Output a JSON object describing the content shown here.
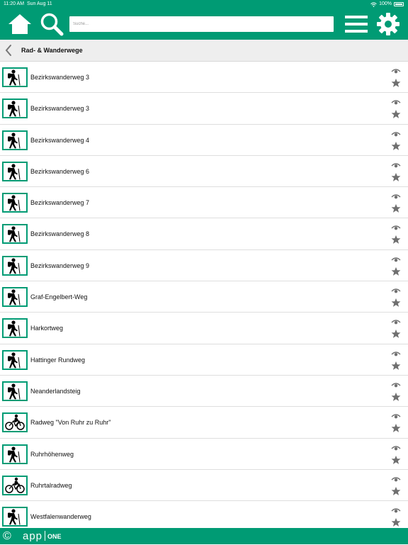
{
  "status_bar": {
    "time": "11:20 AM",
    "date": "Sun Aug 11",
    "battery": "100%"
  },
  "toolbar": {
    "search_placeholder": "Suche...",
    "home_icon": "home-icon",
    "search_icon": "search-icon",
    "menu_icon": "hamburger-menu-icon",
    "settings_icon": "gear-icon"
  },
  "nav": {
    "title": "Rad- & Wanderwege"
  },
  "routes": [
    {
      "label": "Bezirkswanderweg 3",
      "kind": "hiking"
    },
    {
      "label": "Bezirkswanderweg 3",
      "kind": "hiking"
    },
    {
      "label": "Bezirkswanderweg 4",
      "kind": "hiking"
    },
    {
      "label": "Bezirkswanderweg 6",
      "kind": "hiking"
    },
    {
      "label": "Bezirkswanderweg 7",
      "kind": "hiking"
    },
    {
      "label": "Bezirkswanderweg 8",
      "kind": "hiking"
    },
    {
      "label": "Bezirkswanderweg 9",
      "kind": "hiking"
    },
    {
      "label": "Graf-Engelbert-Weg",
      "kind": "hiking"
    },
    {
      "label": "Harkortweg",
      "kind": "hiking"
    },
    {
      "label": "Hattinger Rundweg",
      "kind": "hiking"
    },
    {
      "label": "Neanderlandsteig",
      "kind": "hiking"
    },
    {
      "label": "Radweg \"Von Ruhr zu Ruhr\"",
      "kind": "cycling"
    },
    {
      "label": "Ruhrhöhenweg",
      "kind": "hiking"
    },
    {
      "label": "Ruhrtalradweg",
      "kind": "cycling"
    },
    {
      "label": "Westfalenwanderweg",
      "kind": "hiking"
    }
  ],
  "footer": {
    "copyright": "©",
    "brand_app": "app",
    "brand_one": "ONE"
  },
  "colors": {
    "brand": "#009b74",
    "nav_bg": "#eeeeee",
    "icon_gray": "#6f6f6f"
  }
}
